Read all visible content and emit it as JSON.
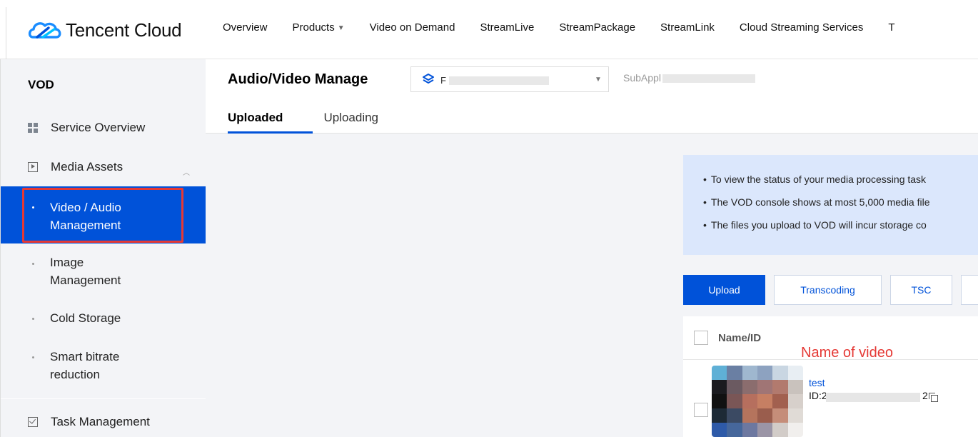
{
  "topbar": {
    "brand": "Tencent Cloud",
    "nav": [
      "Overview",
      "Products",
      "Video on Demand",
      "StreamLive",
      "StreamPackage",
      "StreamLink",
      "Cloud Streaming Services",
      "T"
    ]
  },
  "sidebar": {
    "title": "VOD",
    "service_overview": "Service Overview",
    "media_assets": "Media Assets",
    "video_audio": "Video / Audio Management",
    "image_mgmt": "Image Management",
    "cold_storage": "Cold Storage",
    "smart_bitrate": "Smart bitrate reduction",
    "task_mgmt": "Task Management"
  },
  "main": {
    "page_title": "Audio/Video Manage",
    "app_select_prefix": "F",
    "subapp_label": "SubAppl",
    "tabs": [
      "Uploaded",
      "Uploading"
    ],
    "notices": [
      "To view the status of your media processing task",
      "The VOD console shows at most 5,000 media file",
      "The files you upload to VOD will incur storage co"
    ],
    "buttons": {
      "upload": "Upload",
      "transcoding": "Transcoding",
      "tsc": "TSC"
    },
    "table": {
      "col_name": "Name/ID",
      "annotation": "Name of video",
      "row": {
        "name": "test",
        "id_prefix": "ID:2",
        "id_suffix": "2"
      }
    }
  },
  "colors": {
    "primary": "#0052d9",
    "annotation": "#e53935",
    "notice_bg": "#dbe7fc",
    "sidebar_bg": "#f3f4f7"
  }
}
